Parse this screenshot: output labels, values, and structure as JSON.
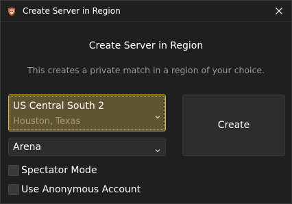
{
  "window": {
    "title": "Create Server in Region",
    "icon": "app-logo-icon",
    "close_icon": "close-icon"
  },
  "dialog": {
    "heading": "Create Server in Region",
    "subtitle": "This creates a private match in a region of your choice."
  },
  "region_select": {
    "selected_name": "US Central South 2",
    "selected_location": "Houston, Texas",
    "icon": "chevron-down-icon"
  },
  "mode_select": {
    "selected": "Arena",
    "icon": "chevron-down-icon"
  },
  "create_button": {
    "label": "Create"
  },
  "options": [
    {
      "label": "Spectator Mode",
      "checked": false
    },
    {
      "label": "Use Anonymous Account",
      "checked": false
    }
  ],
  "colors": {
    "background": "#1f1f1f",
    "selected_bg": "#5f5532",
    "selected_border": "#d8b72e",
    "text": "#ffffff",
    "muted_text": "#9a9a9a"
  }
}
